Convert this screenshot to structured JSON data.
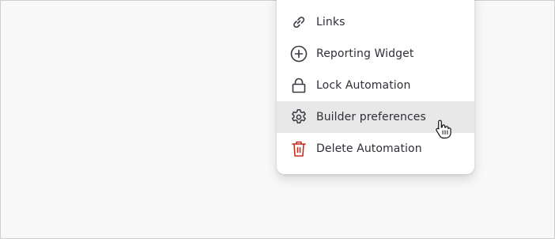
{
  "menu": {
    "items": [
      {
        "label": "Links",
        "icon": "link-icon"
      },
      {
        "label": "Reporting Widget",
        "icon": "plus-circle-icon"
      },
      {
        "label": "Lock Automation",
        "icon": "lock-icon"
      },
      {
        "label": "Builder preferences",
        "icon": "gear-icon",
        "hovered": true
      },
      {
        "label": "Delete Automation",
        "icon": "trash-icon",
        "danger": true
      }
    ]
  },
  "colors": {
    "background": "#f8f8f8",
    "menu_background": "#ffffff",
    "hover_background": "#e8e8e8",
    "text": "#2f2f36",
    "icon": "#3a3a42",
    "danger": "#c62d1f"
  }
}
